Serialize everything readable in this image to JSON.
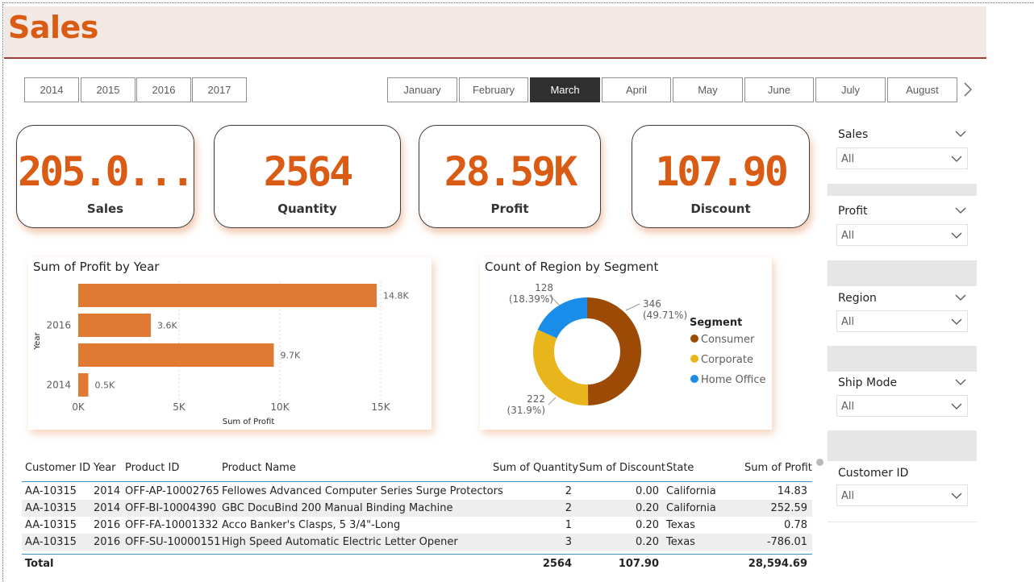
{
  "page": {
    "title": "Sales"
  },
  "years": [
    "2014",
    "2015",
    "2016",
    "2017"
  ],
  "months": [
    "January",
    "February",
    "March",
    "April",
    "May",
    "June",
    "July",
    "August"
  ],
  "selected_month": "March",
  "kpis": [
    {
      "value": "205.0...",
      "label": "Sales"
    },
    {
      "value": "2564",
      "label": "Quantity"
    },
    {
      "value": "28.59K",
      "label": "Profit"
    },
    {
      "value": "107.90",
      "label": "Discount"
    }
  ],
  "filters": [
    {
      "name": "Sales",
      "value": "All"
    },
    {
      "name": "Profit",
      "value": "All"
    },
    {
      "name": "Region",
      "value": "All"
    },
    {
      "name": "Ship Mode",
      "value": "All"
    },
    {
      "name": "Customer ID",
      "value": "All"
    }
  ],
  "colors": {
    "accent": "#d95b14",
    "bar": "#e07932",
    "consumer": "#9c4a05",
    "corporate": "#e8b51c",
    "home_office": "#1a8de9",
    "selected": "#2f2f2f",
    "header_bg": "#f2e8e4"
  },
  "chart_data": [
    {
      "type": "bar",
      "orientation": "horizontal",
      "title": "Sum of Profit by Year",
      "xlabel": "Sum of Profit",
      "ylabel": "Year",
      "categories": [
        "",
        "2016",
        "",
        "2014"
      ],
      "values": [
        14.8,
        3.6,
        9.7,
        0.5
      ],
      "value_labels": [
        "14.8K",
        "3.6K",
        "9.7K",
        "0.5K"
      ],
      "x_ticks": [
        "0K",
        "5K",
        "10K",
        "15K"
      ],
      "xlim": [
        0,
        17
      ],
      "grid": true
    },
    {
      "type": "pie",
      "variant": "donut",
      "title": "Count of Region by Segment",
      "legend_title": "Segment",
      "legend_position": "right",
      "series": [
        {
          "name": "Consumer",
          "value": 346,
          "percent": "(49.71%)"
        },
        {
          "name": "Corporate",
          "value": 222,
          "percent": "(31.9%)"
        },
        {
          "name": "Home Office",
          "value": 128,
          "percent": "(18.39%)"
        }
      ]
    }
  ],
  "table": {
    "columns": [
      "Customer ID",
      "Year",
      "Product ID",
      "Product Name",
      "Sum of Quantity",
      "Sum of Discount",
      "State",
      "Sum of Profit"
    ],
    "rows": [
      [
        "AA-10315",
        "2014",
        "OFF-AP-10002765",
        "Fellowes Advanced Computer Series Surge Protectors",
        "2",
        "0.00",
        "California",
        "14.83"
      ],
      [
        "AA-10315",
        "2014",
        "OFF-BI-10004390",
        "GBC DocuBind 200 Manual Binding Machine",
        "2",
        "0.20",
        "California",
        "252.59"
      ],
      [
        "AA-10315",
        "2016",
        "OFF-FA-10001332",
        "Acco Banker's Clasps, 5 3/4\"-Long",
        "1",
        "0.20",
        "Texas",
        "0.78"
      ],
      [
        "AA-10315",
        "2016",
        "OFF-SU-10000151",
        "High Speed Automatic Electric Letter Opener",
        "3",
        "0.20",
        "Texas",
        "-786.01"
      ]
    ],
    "total": {
      "label": "Total",
      "quantity": "2564",
      "discount": "107.90",
      "profit": "28,594.69"
    }
  }
}
